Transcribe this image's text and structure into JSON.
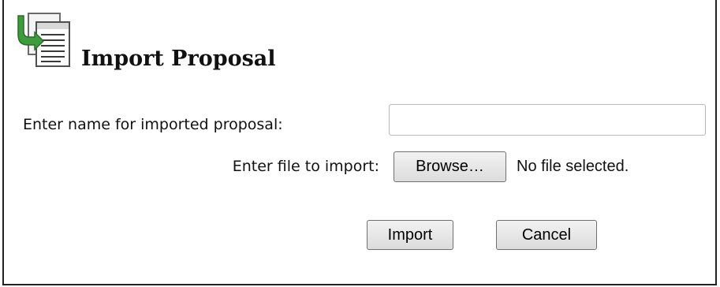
{
  "dialog": {
    "title": "Import Proposal",
    "icon": "document-import-icon"
  },
  "form": {
    "name_label": "Enter name for imported proposal:",
    "name_value": "",
    "name_placeholder": "",
    "file_label": "Enter file to import:",
    "browse_label": "Browse…",
    "file_status": "No file selected."
  },
  "actions": {
    "import_label": "Import",
    "cancel_label": "Cancel"
  },
  "colors": {
    "border": "#222222",
    "icon_green": "#3e9b3e",
    "button_border": "#707070"
  }
}
